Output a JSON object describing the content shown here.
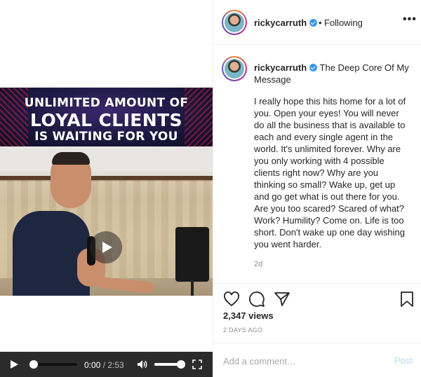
{
  "video": {
    "banner_line1": "UNLIMITED AMOUNT OF",
    "banner_line2": "LOYAL CLIENTS",
    "banner_line3": "IS WAITING FOR YOU",
    "controls": {
      "current_time": "0:00",
      "separator": " / ",
      "duration": "2:53",
      "progress": 0.0,
      "volume": 0.9
    }
  },
  "header": {
    "username": "rickycarruth",
    "verified": true,
    "dot": "•",
    "follow_state": "Following",
    "more_icon": "ellipsis-icon"
  },
  "caption": {
    "username": "rickycarruth",
    "title": "The Deep Core Of My Message",
    "body": "I really hope this hits home for a lot of you. Open your eyes! You will never do all the business that is available to each and every single agent in the world. It's unlimited forever. Why are you only working with 4 possible clients right now? Why are you thinking so small? Wake up, get up and go get what is out there for you. Are you too scared? Scared of what? Work? Humility? Come on. Life is too short. Don't wake up one day wishing you went harder.",
    "time_ago": "2d"
  },
  "actions": {
    "like_icon": "heart-icon",
    "comment_icon": "comment-icon",
    "share_icon": "paper-plane-icon",
    "save_icon": "bookmark-icon"
  },
  "stats": {
    "likes": "2,347 views",
    "date": "2 DAYS AGO"
  },
  "comment": {
    "placeholder": "Add a comment…",
    "post_label": "Post"
  },
  "colors": {
    "accent_blue": "#3897f0",
    "post_disabled": "#b3dbff",
    "muted": "#8e8e8e",
    "control_bar": "#2b2b2b"
  }
}
